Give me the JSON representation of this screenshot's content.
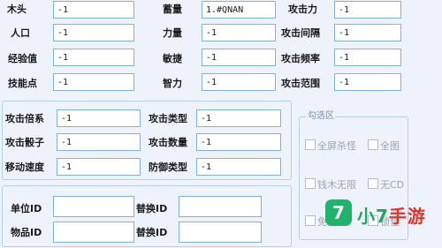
{
  "top_fields": {
    "wood": {
      "label": "木头",
      "value": "-1"
    },
    "troops": {
      "label": "蓄量",
      "value": "1.#QNAN"
    },
    "attack": {
      "label": "攻击力",
      "value": "-1"
    },
    "population": {
      "label": "人口",
      "value": "-1"
    },
    "power": {
      "label": "力量",
      "value": "-1"
    },
    "attack_interval": {
      "label": "攻击间隔",
      "value": "-1"
    },
    "experience": {
      "label": "经验值",
      "value": "-1"
    },
    "agility": {
      "label": "敏捷",
      "value": "-1"
    },
    "attack_rate": {
      "label": "攻击频率",
      "value": "-1"
    },
    "skill_points": {
      "label": "技能点",
      "value": "-1"
    },
    "intelligence": {
      "label": "智力",
      "value": "-1"
    },
    "attack_range": {
      "label": "攻击范围",
      "value": "-1"
    }
  },
  "mid_fields": {
    "attack_multiplier": {
      "label": "攻击倍系",
      "value": "-1"
    },
    "attack_type": {
      "label": "攻击类型",
      "value": "-1"
    },
    "attack_dice": {
      "label": "攻击骰子",
      "value": "-1"
    },
    "attack_count": {
      "label": "攻击数量",
      "value": "-1"
    },
    "move_speed": {
      "label": "移动速度",
      "value": "-1"
    },
    "defense_type": {
      "label": "防御类型",
      "value": "-1"
    }
  },
  "bottom_fields": {
    "unit_id": {
      "label": "单位ID",
      "value": ""
    },
    "replace_id_1": {
      "label": "替换ID",
      "value": ""
    },
    "item_id": {
      "label": "物品ID",
      "value": ""
    },
    "replace_id_2": {
      "label": "替换ID",
      "value": ""
    }
  },
  "options": {
    "title": "勾选区",
    "items": [
      {
        "label": "全屏杀怪",
        "checked": false
      },
      {
        "label": "全图",
        "checked": false
      },
      {
        "label": "钱木无限",
        "checked": false
      },
      {
        "label": "无CD",
        "checked": false
      },
      {
        "label": "免疫",
        "checked": false
      },
      {
        "label": "锁怪",
        "checked": false
      }
    ]
  },
  "watermark": {
    "icon_text": "7",
    "text_pre": "小7",
    "text_accent": "手游"
  }
}
